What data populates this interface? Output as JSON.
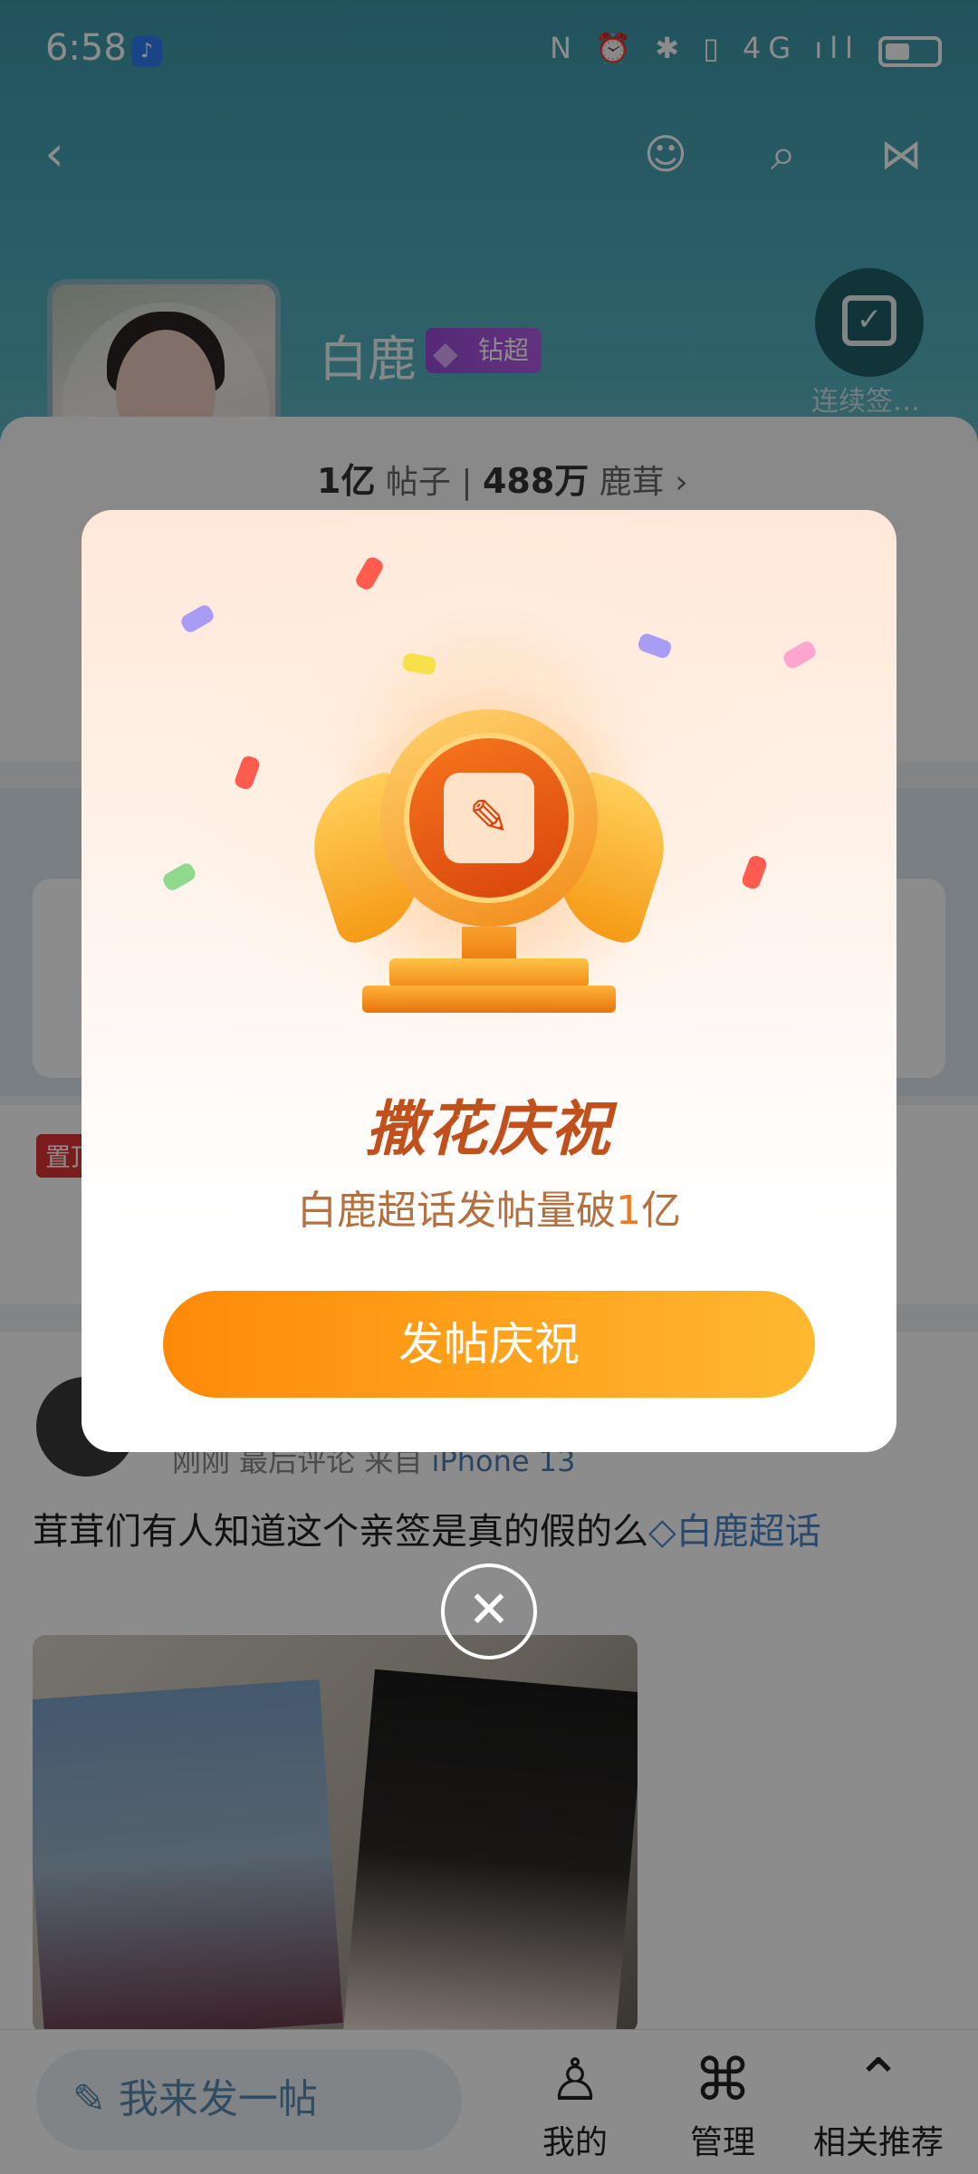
{
  "status_bar": {
    "time": "6:58",
    "right_icons": "N ⏰ ✱ ▯ 4G ıll"
  },
  "header": {
    "topic_name": "白鹿",
    "badge_label": "钻超",
    "checkin_label": "连续签…",
    "stats": {
      "posts_value": "1亿",
      "posts_label": "帖子",
      "fans_value": "488万",
      "fans_label": "鹿茸"
    }
  },
  "post": {
    "meta_time": "刚刚 最后评论",
    "meta_source_prefix": "来自",
    "meta_device": "iPhone 13",
    "text": "茸茸们有人知道这个亲签是真的假的么",
    "topic_link": "白鹿超话",
    "pinned_tag": "置顶"
  },
  "bottom_bar": {
    "compose": "我来发一帖",
    "tabs": [
      {
        "label": "我的",
        "icon": "profile-icon"
      },
      {
        "label": "管理",
        "icon": "grid-icon"
      },
      {
        "label": "相关推荐",
        "icon": "chevron-up-icon"
      }
    ]
  },
  "modal": {
    "title": "撒花庆祝",
    "subtitle_prefix": "白鹿超话发帖量破",
    "subtitle_number": "1",
    "subtitle_suffix": "亿",
    "cta": "发帖庆祝"
  },
  "colors": {
    "accent": "#ff8a08",
    "title": "#c1511c",
    "header_bg": "#49a8b8"
  }
}
